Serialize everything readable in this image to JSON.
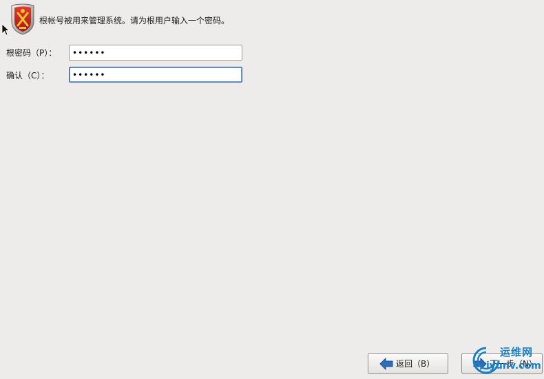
{
  "header": {
    "message": "根帐号被用来管理系统。请为根用户输入一个密码。",
    "logo_icon": "shield-crest-icon"
  },
  "form": {
    "root_password_label": "根密码（P）：",
    "root_password_value": "000000",
    "confirm_label": "确认（C）：",
    "confirm_value": "000000"
  },
  "buttons": {
    "back_label": "返回（B）",
    "back_icon": "arrow-left-icon",
    "next_label": "下一步（N）",
    "next_icon": "arrow-right-icon"
  },
  "watermark": {
    "top_text": "运维网",
    "bottom_text": "iyunv.com"
  },
  "colors": {
    "background": "#edeceb",
    "accent": "#3465a4",
    "watermark": "#1b7fc4"
  }
}
